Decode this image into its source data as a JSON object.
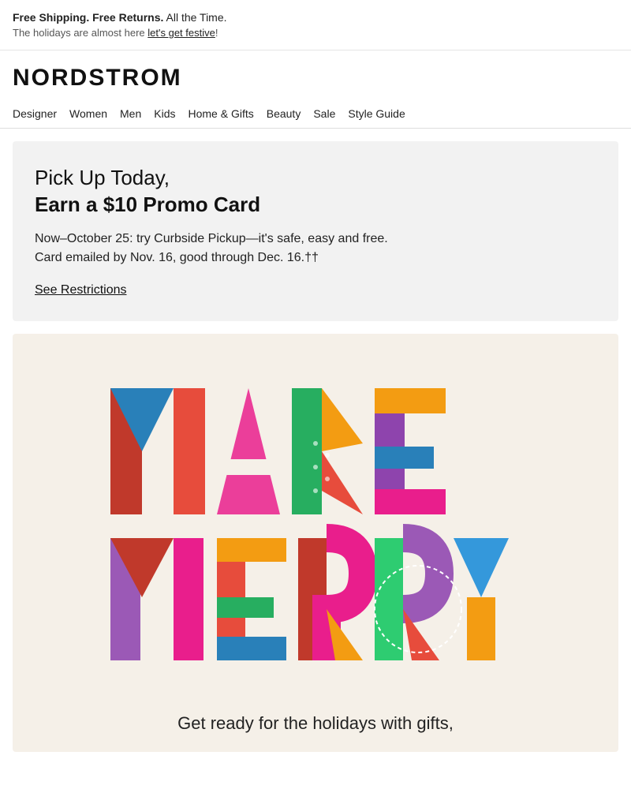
{
  "top_banner": {
    "bold_text": "Free Shipping. Free Returns.",
    "regular_text": " All the Time.",
    "sub_text": "The holidays are almost here ",
    "sub_link": "let's get festive",
    "sub_end": "!"
  },
  "logo": {
    "text": "NORDSTROM"
  },
  "nav": {
    "items": [
      {
        "label": "Designer"
      },
      {
        "label": "Women"
      },
      {
        "label": "Men"
      },
      {
        "label": "Kids"
      },
      {
        "label": "Home & Gifts"
      },
      {
        "label": "Beauty"
      },
      {
        "label": "Sale"
      },
      {
        "label": "Style Guide"
      }
    ]
  },
  "promo": {
    "title_line1": "Pick Up Today,",
    "title_line2": "Earn a $10 Promo Card",
    "body_line1": "Now–October 25: try Curbside Pickup—it's safe, easy and free.",
    "body_line2": "Card emailed by Nov. 16, good through Dec. 16.††",
    "link_text": "See Restrictions"
  },
  "make_merry": {
    "subtitle": "Get ready for the holidays with gifts,"
  }
}
